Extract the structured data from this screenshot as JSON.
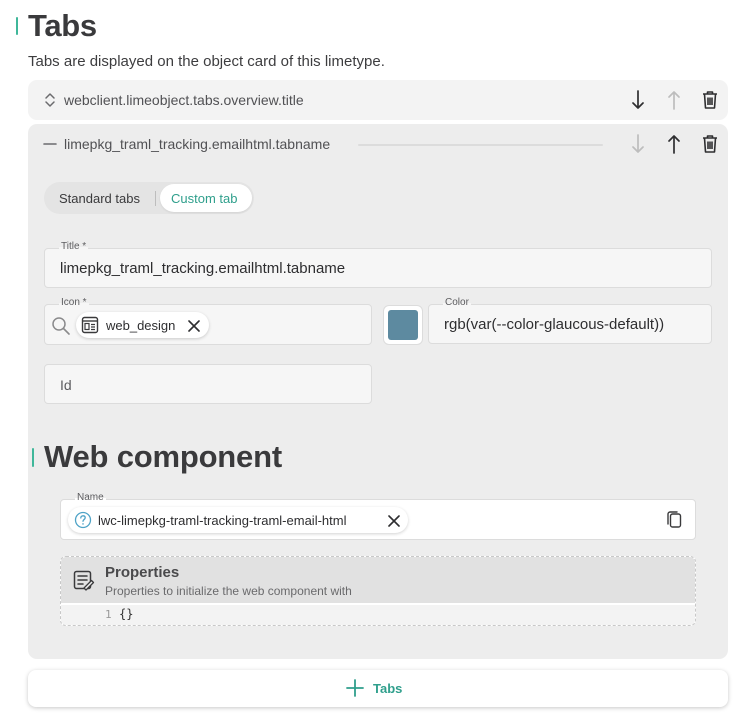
{
  "page": {
    "title": "Tabs",
    "subtitle": "Tabs are displayed on the object card of this limetype."
  },
  "tabs": [
    {
      "label": "webclient.limeobject.tabs.overview.title",
      "state": "collapsed",
      "icons": [
        "unfold-icon",
        "arrow-down-icon",
        "arrow-up-icon",
        "trash-icon"
      ]
    },
    {
      "label": "limepkg_traml_tracking.emailhtml.tabname",
      "state": "expanded",
      "icons": [
        "collapse-icon",
        "arrow-down-icon",
        "arrow-up-icon",
        "trash-icon"
      ]
    }
  ],
  "tab_type": {
    "options": [
      "Standard tabs",
      "Custom tab"
    ],
    "selected": "Custom tab"
  },
  "form": {
    "title_label": "Title *",
    "title_value": "limepkg_traml_tracking.emailhtml.tabname",
    "icon_label": "Icon *",
    "icon_value": "web_design",
    "color_label": "Color",
    "color_value": "rgb(var(--color-glaucous-default))",
    "swatch_color": "#5d8aa0",
    "id_placeholder": "Id"
  },
  "web_component": {
    "section_title": "Web component",
    "name_label": "Name",
    "name_value": "lwc-limepkg-traml-tracking-traml-email-html",
    "properties_title": "Properties",
    "properties_description": "Properties to initialize the web component with",
    "code_line_number": "1",
    "code_value": "{}"
  },
  "add_button": {
    "label": "Tabs"
  },
  "colors": {
    "accent": "#3fb79a",
    "accent_text": "#2f9f8c",
    "card_bg": "#ededed"
  }
}
